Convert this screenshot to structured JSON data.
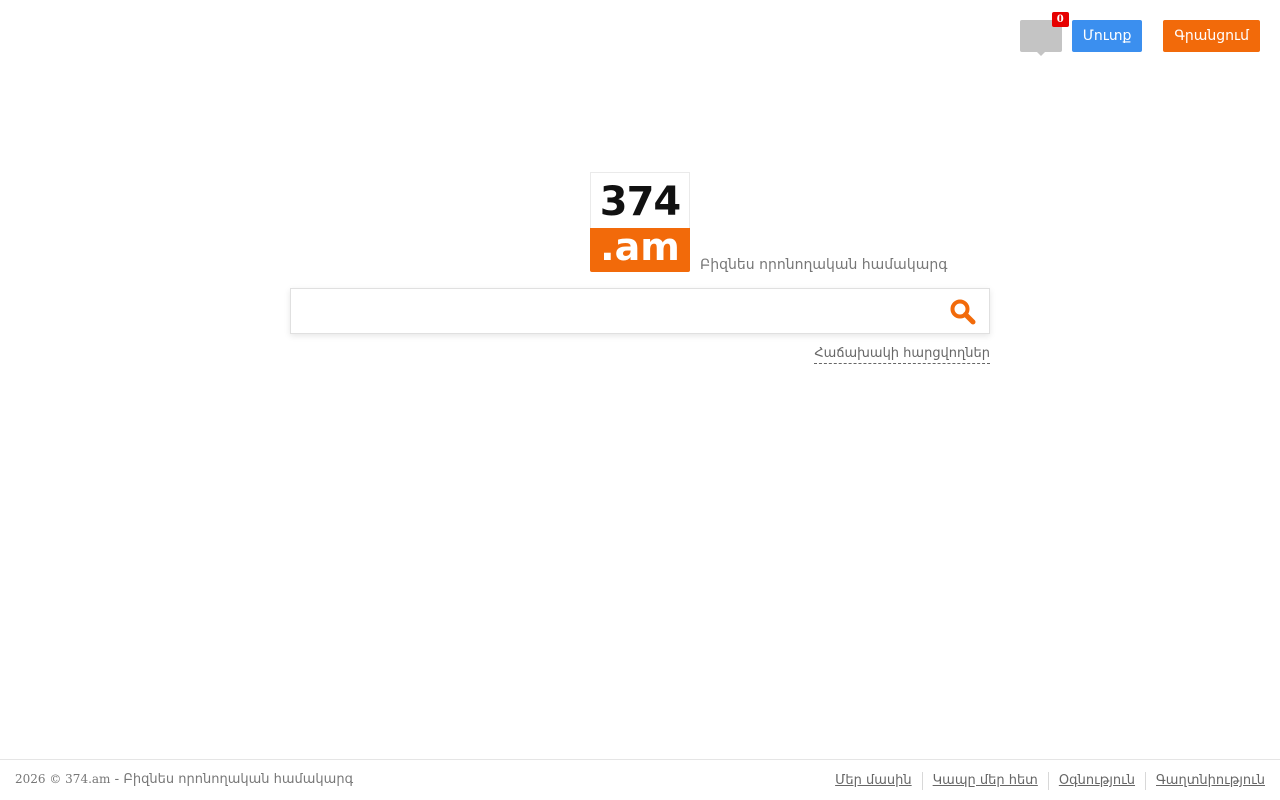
{
  "header": {
    "messages_badge": "0",
    "login_label": "Մուտք",
    "register_label": "Գրանցում"
  },
  "logo": {
    "top_text": "374",
    "bottom_text": ".am",
    "tagline": "Բիզնես որոնողական համակարգ"
  },
  "search": {
    "value": "",
    "placeholder": "",
    "faq_label": "Հաճախակի հարցվողներ"
  },
  "footer": {
    "copyright": "2026 © 374.am",
    "separator": " - ",
    "tagline": "Բիզնես որոնողական համակարգ",
    "links": [
      "Մեր մասին",
      "Կապը մեր հետ",
      "Օգնություն",
      "Գաղտնիություն"
    ]
  },
  "colors": {
    "accent_orange": "#f26a0a",
    "login_blue": "#3b8fef",
    "badge_red": "#e60000",
    "icon_gray": "#c4c4c4"
  },
  "icons": {
    "messages": "speech-bubble-icon",
    "search": "magnifier-icon"
  }
}
